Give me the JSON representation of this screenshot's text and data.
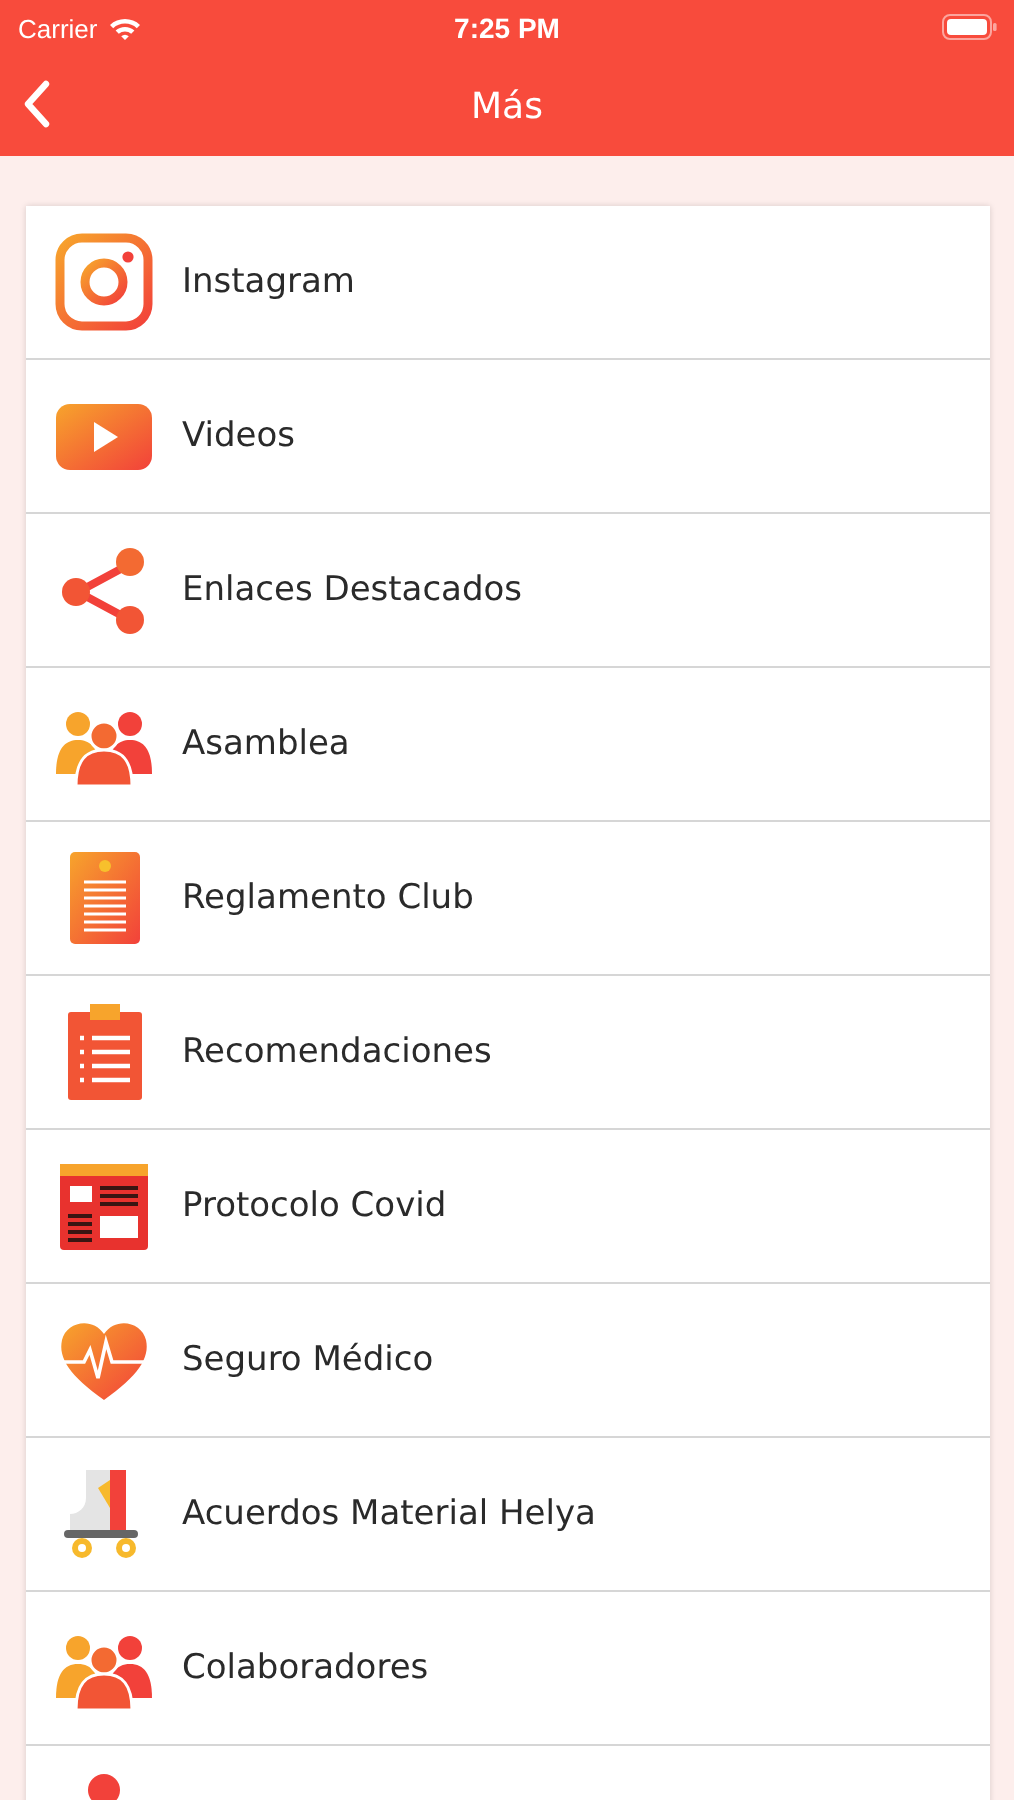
{
  "status_bar": {
    "carrier": "Carrier",
    "time": "7:25 PM"
  },
  "nav": {
    "title": "Más"
  },
  "items": [
    {
      "kind": "instagram",
      "label": "Instagram"
    },
    {
      "kind": "video",
      "label": "Videos"
    },
    {
      "kind": "share",
      "label": "Enlaces Destacados"
    },
    {
      "kind": "people",
      "label": "Asamblea"
    },
    {
      "kind": "document",
      "label": "Reglamento Club"
    },
    {
      "kind": "clipboard",
      "label": "Recomendaciones"
    },
    {
      "kind": "webpage",
      "label": "Protocolo Covid"
    },
    {
      "kind": "heart",
      "label": "Seguro Médico"
    },
    {
      "kind": "skate",
      "label": "Acuerdos Material Helya"
    },
    {
      "kind": "people",
      "label": "Colaboradores"
    },
    {
      "kind": "pin"
    }
  ]
}
